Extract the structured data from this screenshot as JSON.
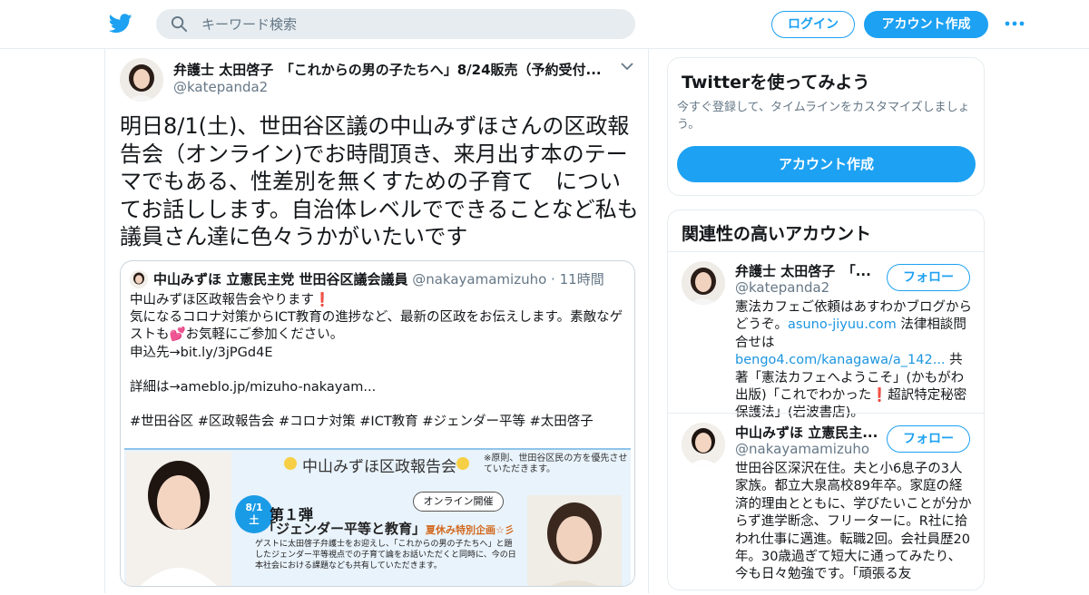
{
  "header": {
    "search_placeholder": "キーワード検索",
    "login_label": "ログイン",
    "signup_label": "アカウント作成"
  },
  "tweet": {
    "author_name": "弁護士 太田啓子　「これからの男の子たちへ」8/24販売（予約受付...",
    "author_handle": "@katepanda2",
    "text": "明日8/1(土)、世田谷区議の中山みずほさんの区政報告会（オンライン)でお時間頂き、来月出す本のテーマでもある、性差別を無くすための子育て　についてお話しします。自治体レベルでできることなど私も議員さん達に色々うかがいたいです",
    "quote": {
      "name": "中山みずほ 立憲民主党 世田谷区議会議員",
      "handle": "@nakayamamizuho",
      "dot": "·",
      "time": "11時間",
      "line1": "中山みずほ区政報告会やります",
      "line2": "気になるコロナ対策からICT教育の進捗など、最新の区政をお伝えします。素敵なゲストも",
      "line2b": "お気軽にご参加ください。",
      "line3": "申込先→bit.ly/3jPGd4E",
      "line4": "詳細は→ameblo.jp/mizuho-nakayam...",
      "line5": "#世田谷区 #区政報告会 #コロナ対策 #ICT教育 #ジェンダー平等 #太田啓子",
      "flyer": {
        "title": "中山みずほ区政報告会",
        "note": "※原則、世田谷区民の方を優先させていただきます。",
        "badge_date": "8/1",
        "badge_day": "土",
        "online": "オンライン開催",
        "vol": "第１弾",
        "sub": "「ジェンダー平等と教育」",
        "sub_small": "夏休み特別企画☆彡",
        "body": "ゲストに太田啓子弁護士をお迎えし、「これからの男の子たちへ」と題したジェンダー平等視点での子育て論をお話いただくと同時に、今の日本社会における課題なども共有していただきます。"
      }
    }
  },
  "sidebar": {
    "try_title": "Twitterを使ってみよう",
    "try_desc": "今すぐ登録して、タイムラインをカスタマイズしましょう。",
    "try_button": "アカウント作成",
    "related_title": "関連性の高いアカウント",
    "accounts": [
      {
        "name": "弁護士 太田啓子　「...",
        "handle": "@katepanda2",
        "follow": "フォロー",
        "bio_a": "憲法カフェご依頼はあすわかブログからどうぞ。",
        "link1": "asuno-jiyuu.com",
        "bio_b": " 法律相談問合せは",
        "link2": "bengo4.com/kanagawa/a_142...",
        "bio_c": " 共著「憲法カフェへようこそ」(かもがわ出版)「これでわかった",
        "bio_d": "超訳特定秘密保護法」(岩波書店)。"
      },
      {
        "name": "中山みずほ 立憲民主...",
        "handle": "@nakayamamizuho",
        "follow": "フォロー",
        "bio": "世田谷区深沢在住。夫と小6息子の3人家族。都立大泉高校89年卒。家庭の経済的理由とともに、学びたいことが分からず進学断念、フリーターに。R社に拾われ仕事に邁進。転職2回。会社員歴20年。30歳過ぎて短大に通ってみたり、今も日々勉強です。「頑張る友"
      }
    ]
  },
  "colors": {
    "accent": "#1da1f2",
    "text": "#14171a",
    "muted": "#657786",
    "border": "#e6ecf0"
  },
  "icons": [
    "twitter-bird-icon",
    "search-icon",
    "more-dots-icon",
    "chevron-down-icon",
    "exclamation-icon",
    "heart-icon"
  ]
}
